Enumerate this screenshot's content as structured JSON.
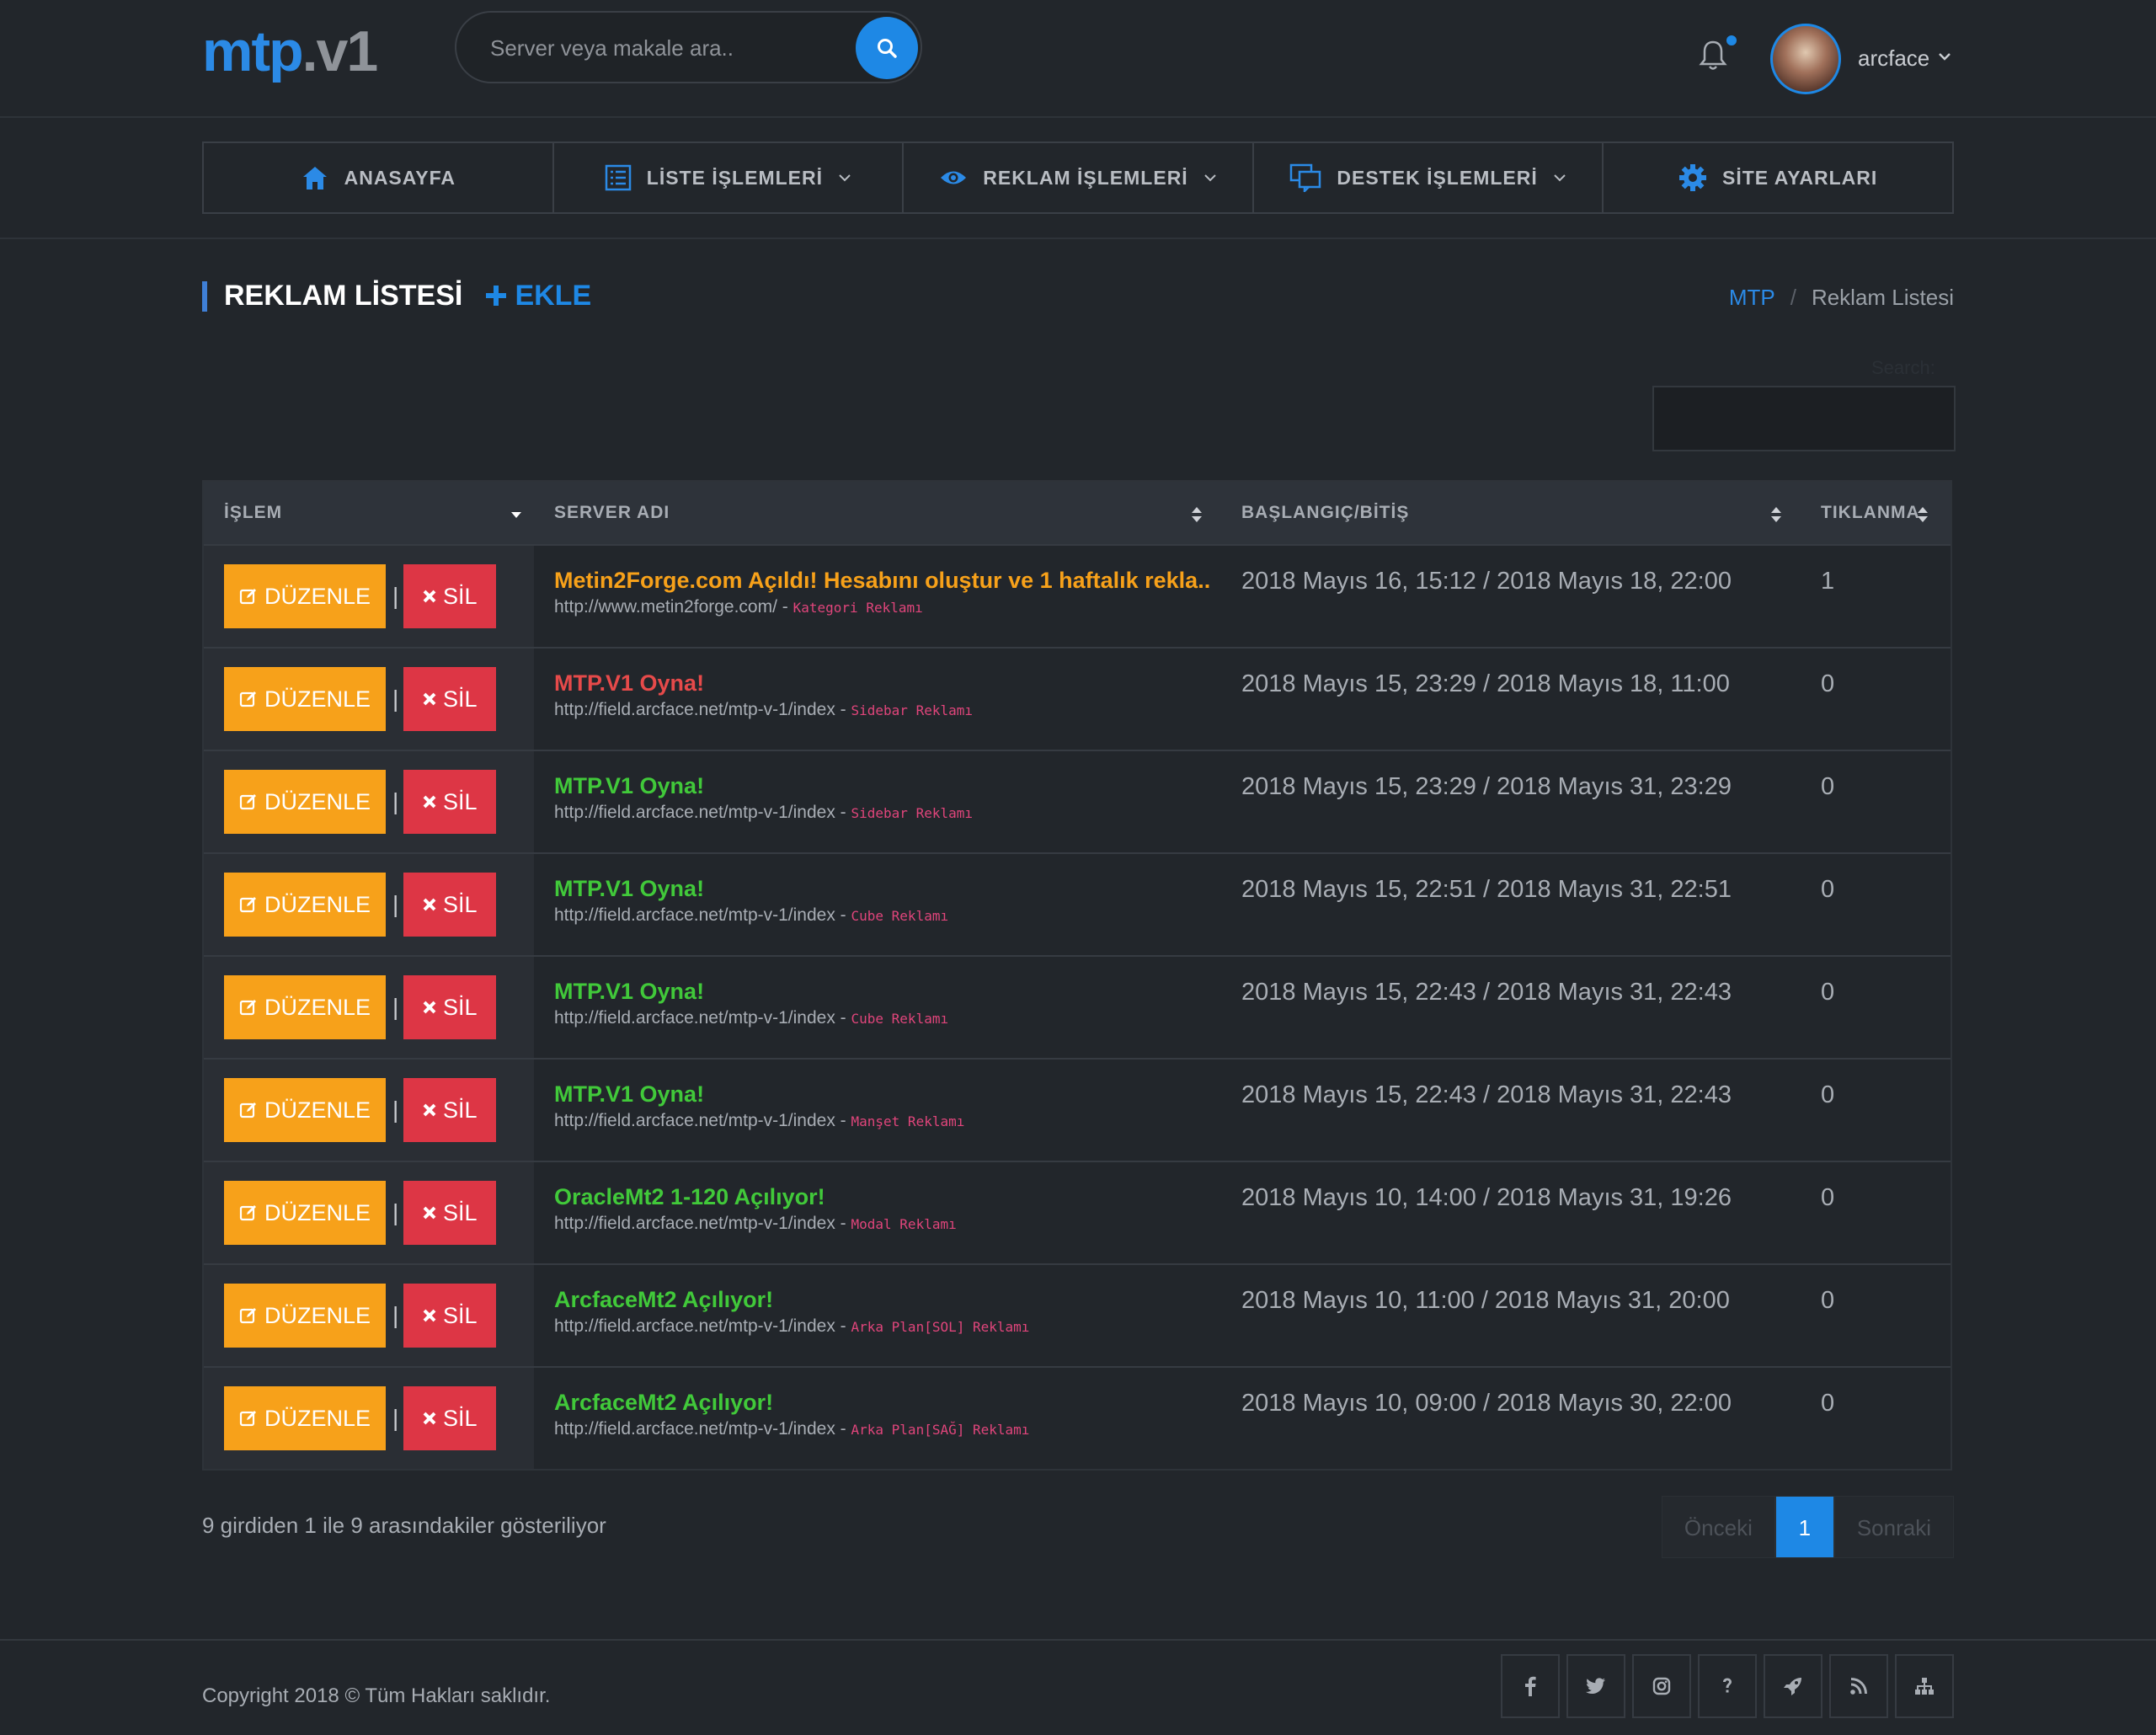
{
  "header": {
    "logo_part1": "mtp",
    "logo_part2": ".v1",
    "search_placeholder": "Server veya makale ara..",
    "user_name": "arcface"
  },
  "nav": {
    "items": [
      {
        "label": "ANASAYFA",
        "icon": "home-icon"
      },
      {
        "label": "LİSTE İŞLEMLERİ",
        "icon": "list-icon"
      },
      {
        "label": "REKLAM İŞLEMLERİ",
        "icon": "eye-icon"
      },
      {
        "label": "DESTEK İŞLEMLERİ",
        "icon": "chat-icon"
      },
      {
        "label": "SİTE AYARLARI",
        "icon": "gear-icon"
      }
    ]
  },
  "page": {
    "title": "REKLAM LİSTESİ",
    "add_label": "EKLE",
    "breadcrumb_home": "MTP",
    "breadcrumb_current": "Reklam Listesi",
    "search_label": "Search:"
  },
  "table": {
    "headers": [
      "İŞLEM",
      "SERVER ADI",
      "BAŞLANGIÇ/BİTİŞ",
      "TIKLANMA"
    ],
    "edit_label": "DÜZENLE",
    "delete_label": "SİL",
    "rows": [
      {
        "name": "Metin2Forge.com Açıldı! Hesabını oluştur ve 1 haftalık rekla..",
        "color": "orange",
        "url": "http://www.metin2forge.com/",
        "type": "Kategori Reklamı",
        "dates": "2018 Mayıs 16, 15:12 / 2018 Mayıs 18, 22:00",
        "clicks": "1"
      },
      {
        "name": "MTP.V1 Oyna!",
        "color": "red",
        "url": "http://field.arcface.net/mtp-v-1/index",
        "type": "Sidebar Reklamı",
        "dates": "2018 Mayıs 15, 23:29 / 2018 Mayıs 18, 11:00",
        "clicks": "0"
      },
      {
        "name": "MTP.V1 Oyna!",
        "color": "green",
        "url": "http://field.arcface.net/mtp-v-1/index",
        "type": "Sidebar Reklamı",
        "dates": "2018 Mayıs 15, 23:29 / 2018 Mayıs 31, 23:29",
        "clicks": "0"
      },
      {
        "name": "MTP.V1 Oyna!",
        "color": "green",
        "url": "http://field.arcface.net/mtp-v-1/index",
        "type": "Cube Reklamı",
        "dates": "2018 Mayıs 15, 22:51 / 2018 Mayıs 31, 22:51",
        "clicks": "0"
      },
      {
        "name": "MTP.V1 Oyna!",
        "color": "green",
        "url": "http://field.arcface.net/mtp-v-1/index",
        "type": "Cube Reklamı",
        "dates": "2018 Mayıs 15, 22:43 / 2018 Mayıs 31, 22:43",
        "clicks": "0"
      },
      {
        "name": "MTP.V1 Oyna!",
        "color": "green",
        "url": "http://field.arcface.net/mtp-v-1/index",
        "type": "Manşet Reklamı",
        "dates": "2018 Mayıs 15, 22:43 / 2018 Mayıs 31, 22:43",
        "clicks": "0"
      },
      {
        "name": "OracleMt2 1-120 Açılıyor!",
        "color": "green",
        "url": "http://field.arcface.net/mtp-v-1/index",
        "type": "Modal Reklamı",
        "dates": "2018 Mayıs 10, 14:00 / 2018 Mayıs 31, 19:26",
        "clicks": "0"
      },
      {
        "name": "ArcfaceMt2 Açılıyor!",
        "color": "green",
        "url": "http://field.arcface.net/mtp-v-1/index",
        "type": "Arka Plan[SOL] Reklamı",
        "dates": "2018 Mayıs 10, 11:00 / 2018 Mayıs 31, 20:00",
        "clicks": "0"
      },
      {
        "name": "ArcfaceMt2 Açılıyor!",
        "color": "green",
        "url": "http://field.arcface.net/mtp-v-1/index",
        "type": "Arka Plan[SAĞ] Reklamı",
        "dates": "2018 Mayıs 10, 09:00 / 2018 Mayıs 30, 22:00",
        "clicks": "0"
      }
    ]
  },
  "pagination": {
    "info": "9 girdiden 1 ile 9 arasındakiler gösteriliyor",
    "prev": "Önceki",
    "current": "1",
    "next": "Sonraki"
  },
  "footer": {
    "copyright": "Copyright 2018 © Tüm Hakları saklıdır.",
    "social_icons": [
      "facebook-icon",
      "twitter-icon",
      "instagram-icon",
      "help-icon",
      "rocket-icon",
      "rss-icon",
      "sitemap-icon"
    ]
  },
  "colors": {
    "accent": "#1e88e5",
    "edit": "#f7a11a",
    "delete": "#dd3645",
    "active_name": "#41c93a",
    "expired_name": "#e64a4a",
    "featured_name": "#f7a11a"
  }
}
